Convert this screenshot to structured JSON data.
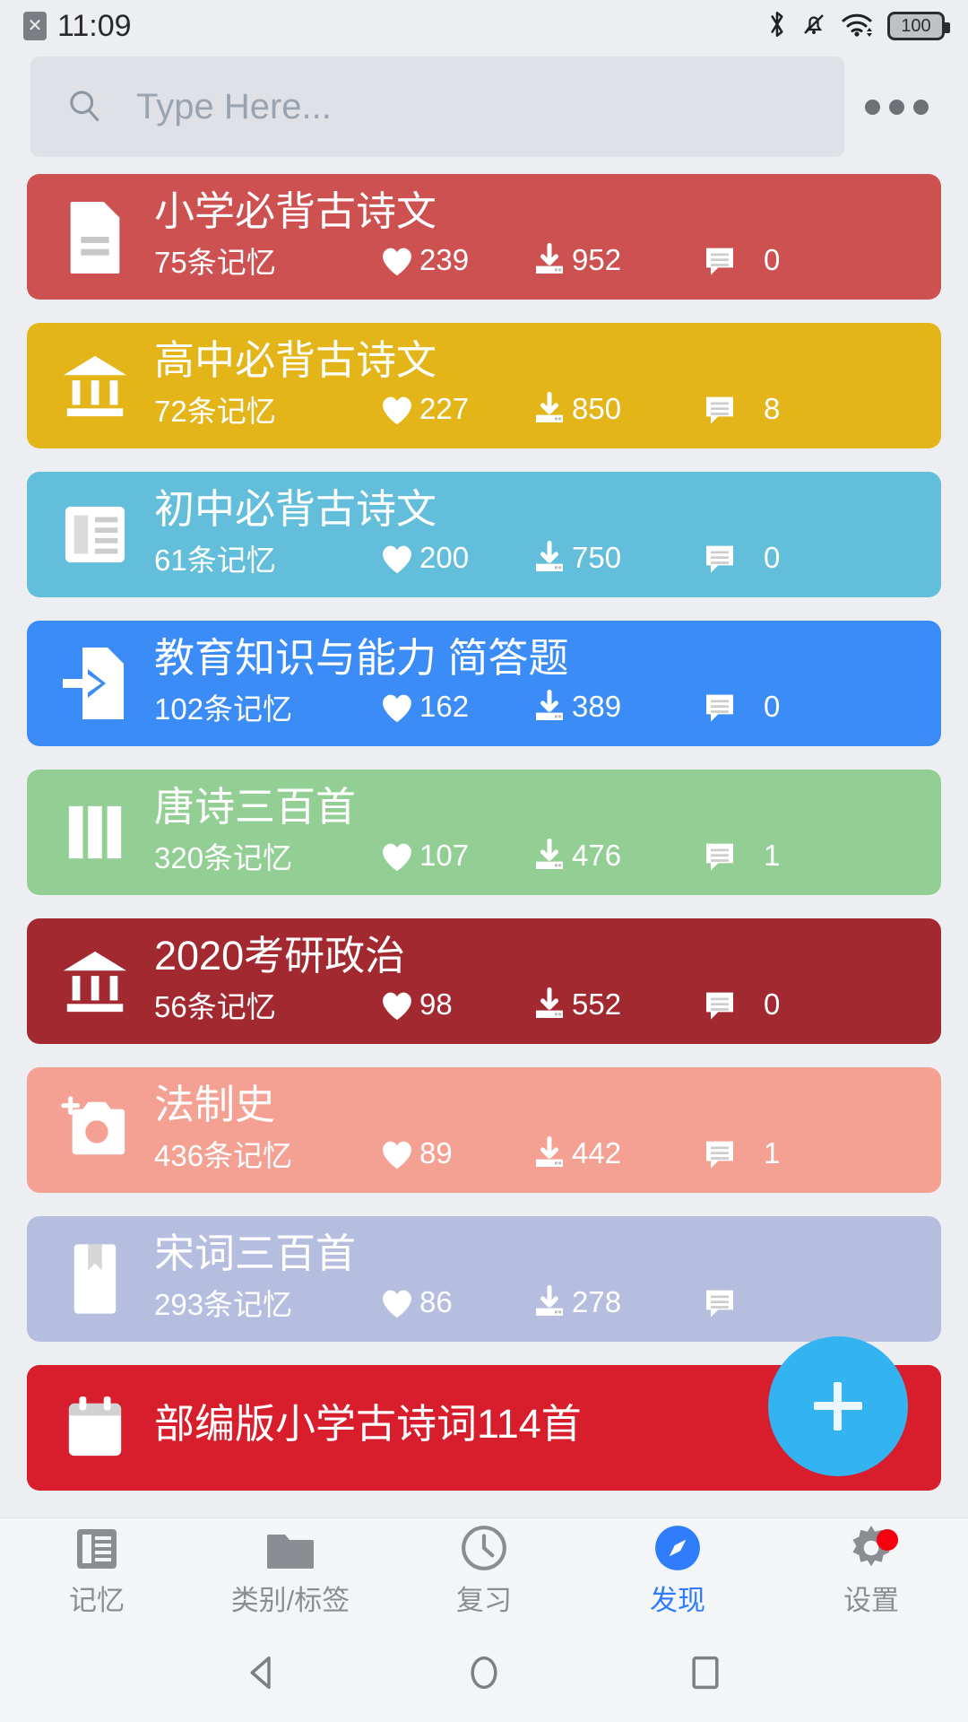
{
  "status_bar": {
    "sim_icon": "sim-card-x-icon",
    "sim_glyph": "✕",
    "time": "11:09",
    "icons": [
      "bluetooth-icon",
      "notification-muted-icon",
      "wifi-icon",
      "battery-icon"
    ],
    "battery_level": "100"
  },
  "search": {
    "placeholder": "Type Here...",
    "value": "",
    "search_icon": "search-icon",
    "overflow_menu": "overflow-menu-icon"
  },
  "cards": [
    {
      "title": "小学必背古诗文",
      "count": "75条记忆",
      "likes": "239",
      "downloads": "952",
      "comments": "0",
      "color": "#ce5151",
      "icon": "document-icon"
    },
    {
      "title": "高中必背古诗文",
      "count": "72条记忆",
      "likes": "227",
      "downloads": "850",
      "comments": "8",
      "color": "#e3b519",
      "icon": "bank-icon"
    },
    {
      "title": "初中必背古诗文",
      "count": "61条记忆",
      "likes": "200",
      "downloads": "750",
      "comments": "0",
      "color": "#62bedb",
      "icon": "article-icon"
    },
    {
      "title": "教育知识与能力 简答题",
      "count": "102条记忆",
      "likes": "162",
      "downloads": "389",
      "comments": "0",
      "color": "#3b8cf7",
      "icon": "import-file-icon"
    },
    {
      "title": "唐诗三百首",
      "count": "320条记忆",
      "likes": "107",
      "downloads": "476",
      "comments": "1",
      "color": "#93cf94",
      "icon": "columns-icon"
    },
    {
      "title": "2020考研政治",
      "count": "56条记忆",
      "likes": "98",
      "downloads": "552",
      "comments": "0",
      "color": "#a32930",
      "icon": "bank-icon"
    },
    {
      "title": "法制史",
      "count": "436条记忆",
      "likes": "89",
      "downloads": "442",
      "comments": "1",
      "color": "#f4a193",
      "icon": "add-photo-icon"
    },
    {
      "title": "宋词三百首",
      "count": "293条记忆",
      "likes": "86",
      "downloads": "278",
      "comments": "",
      "color": "#b6bedf",
      "icon": "bookmark-icon"
    },
    {
      "title": "部编版小学古诗词114首",
      "count": "",
      "likes": "",
      "downloads": "",
      "comments": "",
      "color": "#d81e2d",
      "icon": "calendar-icon"
    }
  ],
  "fab": {
    "label": "+",
    "icon": "plus-icon",
    "color": "#34b3f1"
  },
  "tabs": [
    {
      "label": "记忆",
      "icon": "memory-book-icon",
      "active": false,
      "badge": false
    },
    {
      "label": "类别/标签",
      "icon": "folder-icon",
      "active": false,
      "badge": false
    },
    {
      "label": "复习",
      "icon": "clock-icon",
      "active": false,
      "badge": false
    },
    {
      "label": "发现",
      "icon": "compass-icon",
      "active": true,
      "badge": false
    },
    {
      "label": "设置",
      "icon": "gear-icon",
      "active": false,
      "badge": true
    }
  ],
  "accent_color": "#2f7dfb",
  "nav_bar": {
    "back": "back-triangle-icon",
    "home": "home-circle-icon",
    "recents": "recents-square-icon"
  }
}
